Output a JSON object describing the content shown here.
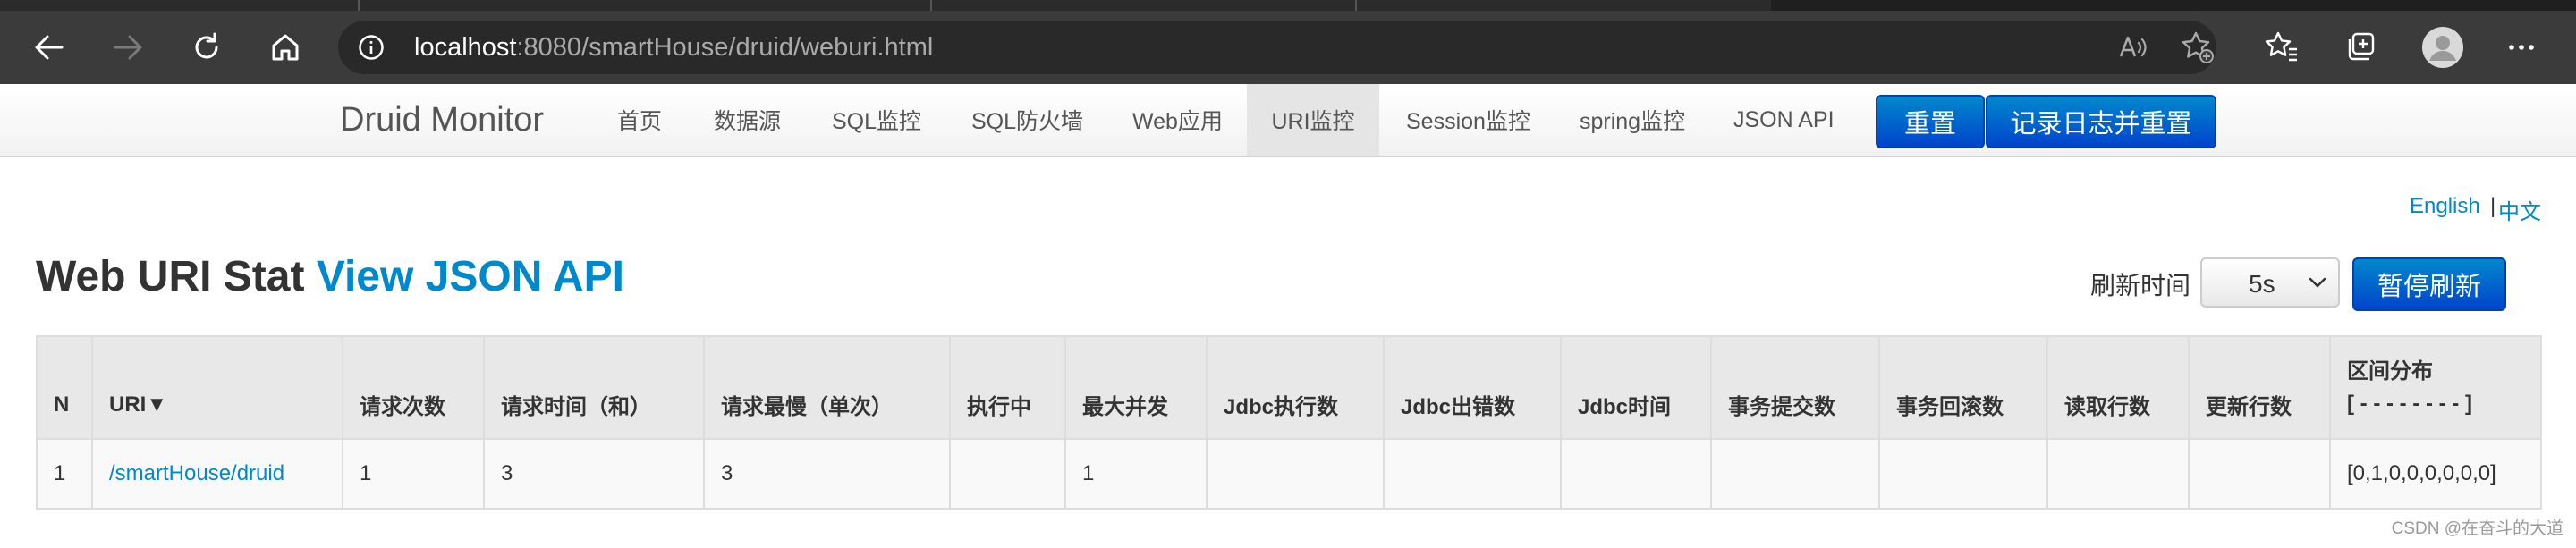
{
  "browser": {
    "url_host": "localhost",
    "url_path": ":8080/smartHouse/druid/weburi.html"
  },
  "nav": {
    "brand": "Druid Monitor",
    "items": [
      "首页",
      "数据源",
      "SQL监控",
      "SQL防火墙",
      "Web应用",
      "URI监控",
      "Session监控",
      "spring监控",
      "JSON API"
    ],
    "active": "URI监控",
    "reset_label": "重置",
    "log_reset_label": "记录日志并重置"
  },
  "lang": {
    "english": "English",
    "separator": "|",
    "chinese": "中文"
  },
  "header": {
    "title": "Web URI Stat",
    "json_link": "View JSON API",
    "refresh_label": "刷新时间",
    "refresh_value": "5s",
    "pause_label": "暂停刷新"
  },
  "table": {
    "columns": [
      "N",
      "URI▼",
      "请求次数",
      "请求时间（和）",
      "请求最慢（单次）",
      "执行中",
      "最大并发",
      "Jdbc执行数",
      "Jdbc出错数",
      "Jdbc时间",
      "事务提交数",
      "事务回滚数",
      "读取行数",
      "更新行数"
    ],
    "dist_header": "区间分布",
    "dist_sub": "[ - - - - - - - - ]",
    "rows": [
      {
        "n": "1",
        "uri": "/smartHouse/druid",
        "count": "1",
        "time_sum": "3",
        "time_max": "3",
        "running": "",
        "concurrent": "1",
        "jdbc_exec": "",
        "jdbc_error": "",
        "jdbc_time": "",
        "tx_commit": "",
        "tx_rollback": "",
        "read_rows": "",
        "update_rows": "",
        "dist": "[0,1,0,0,0,0,0,0]"
      }
    ]
  },
  "watermark": "CSDN @在奋斗的大道"
}
